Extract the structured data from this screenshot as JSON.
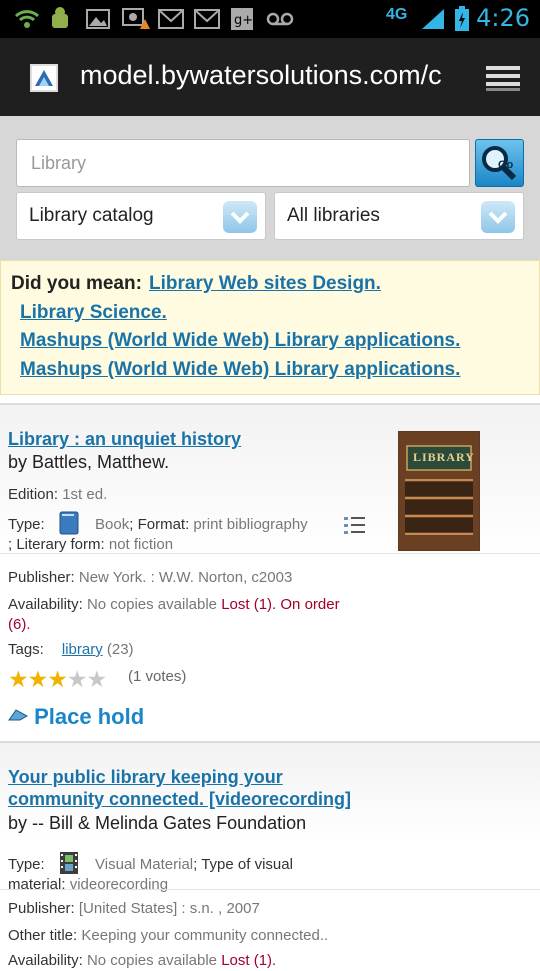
{
  "statusbar": {
    "time": "4:26",
    "network": "4G",
    "icons": [
      "wifi-icon",
      "android-icon",
      "image-icon",
      "photo-alert-icon",
      "gmail-icon",
      "gmail-icon",
      "google-plus-icon",
      "voicemail-icon",
      "signal-icon",
      "battery-icon"
    ]
  },
  "browser": {
    "url": "model.bywatersolutions.com/c"
  },
  "search": {
    "placeholder": "Library",
    "catalog_select": "Library catalog",
    "library_select": "All libraries"
  },
  "did_you_mean": {
    "label": "Did you mean:",
    "suggestions": [
      "Library Web sites Design.",
      "Library Science.",
      "Mashups (World Wide Web) Library applications.",
      "Mashups (World Wide Web) Library applications."
    ]
  },
  "results": [
    {
      "title": "Library : an unquiet history",
      "author": "by Battles, Matthew.",
      "edition_label": "Edition:",
      "edition": "1st ed.",
      "type_label": "Type:",
      "type": "Book",
      "format_label": "; Format:",
      "format": "print bibliography",
      "literary_form_label": "; Literary form:",
      "literary_form": "not fiction",
      "publisher_label": "Publisher:",
      "publisher": "New York. : W.W. Norton, c2003",
      "availability_label": "Availability:",
      "availability": "No copies available",
      "availability_status_1": "Lost (1).",
      "availability_status_2": "On order",
      "availability_status_3": "(6).",
      "tags_label": "Tags:",
      "tag": "library",
      "tag_count": "(23)",
      "rating": 3,
      "rating_max": 5,
      "votes": "(1 votes)",
      "place_hold": "Place hold",
      "cover_text": "LIBRARY"
    },
    {
      "title_line1": "Your public library keeping your",
      "title_line2": "community connected. [videorecording]",
      "author": "by -- Bill & Melinda Gates Foundation",
      "type_label": "Type:",
      "type": "Visual Material",
      "type_visual_label": "; Type of visual",
      "type_visual_label2": "material:",
      "type_visual": "videorecording",
      "publisher_label": "Publisher:",
      "publisher": "[United States] : s.n. , 2007",
      "other_title_label": "Other title:",
      "other_title": "Keeping your community connected..",
      "availability_label": "Availability:",
      "availability": "No copies available",
      "availability_status_1": "Lost (1)."
    }
  ],
  "colors": {
    "link": "#1a73a8",
    "accent": "#33b5e5",
    "lost": "#a0002a",
    "hold": "#1a86c7"
  }
}
